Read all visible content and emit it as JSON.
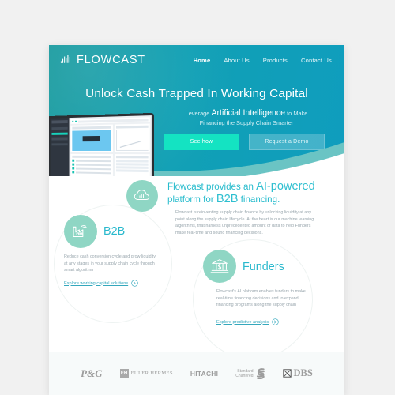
{
  "brand": {
    "name": "FLOWCAST",
    "logo_icon": "soundwave-icon"
  },
  "nav": {
    "items": [
      {
        "label": "Home",
        "active": true
      },
      {
        "label": "About Us",
        "active": false
      },
      {
        "label": "Products",
        "active": false
      },
      {
        "label": "Contact Us",
        "active": false
      }
    ]
  },
  "hero": {
    "title": "Unlock Cash Trapped In Working Capital",
    "subtitle_lead": "Leverage ",
    "subtitle_emphasis": "Artificial Intelligence",
    "subtitle_tail": " to Make",
    "subtitle_line2": "Financing the Supply Chain Smarter",
    "primary_button": "See how",
    "secondary_button": "Request a Demo",
    "background_color": "#11a0b5",
    "primary_button_color": "#14e3c2",
    "wave_color": "#6ac4c4"
  },
  "laptop": {
    "alt": "dashboard-screenshot"
  },
  "intro": {
    "icon": "cloud-analytics-icon",
    "heading_part1": "Flowcast provides an ",
    "heading_emphasis1": "AI-powered",
    "heading_part2": "platform for ",
    "heading_emphasis2": "B2B",
    "heading_part3": " financing.",
    "body": "Flowcast is reinventing supply chain finance by unlocking liquidity at any point along the supply chain lifecycle. At the heart is our machine learning algorithms, that harness unprecedented amount of data to help Funders make real-time and sound financing decisions.",
    "accent_color": "#2ebfd0"
  },
  "b2b": {
    "icon": "factory-icon",
    "title": "B2B",
    "body": "Reduce cash conversion cycle and grow liquidity at any stages in your supply chain cycle through smart algorithm",
    "link_label": "Explore working capital solutions",
    "link_icon": "arrow-right-circle-icon"
  },
  "funders": {
    "icon": "bank-dollar-icon",
    "title": "Funders",
    "body": "Flowcast's AI platform enables funders to make real-time financing decisions and to expand financing programs along the supply chain",
    "link_label": "Explore predictive analysis",
    "link_icon": "arrow-right-circle-icon"
  },
  "partners": {
    "items": [
      {
        "name": "P&G"
      },
      {
        "name": "EULER HERMES",
        "mark": "EH"
      },
      {
        "name": "HITACHI"
      },
      {
        "name": "Standard",
        "name2": "Chartered"
      },
      {
        "name": "DBS"
      }
    ]
  },
  "colors": {
    "page_background": "#f1f1f1",
    "teal": "#11a0b5",
    "mint": "#8fd6c4",
    "text_muted": "#9aa7ae"
  }
}
